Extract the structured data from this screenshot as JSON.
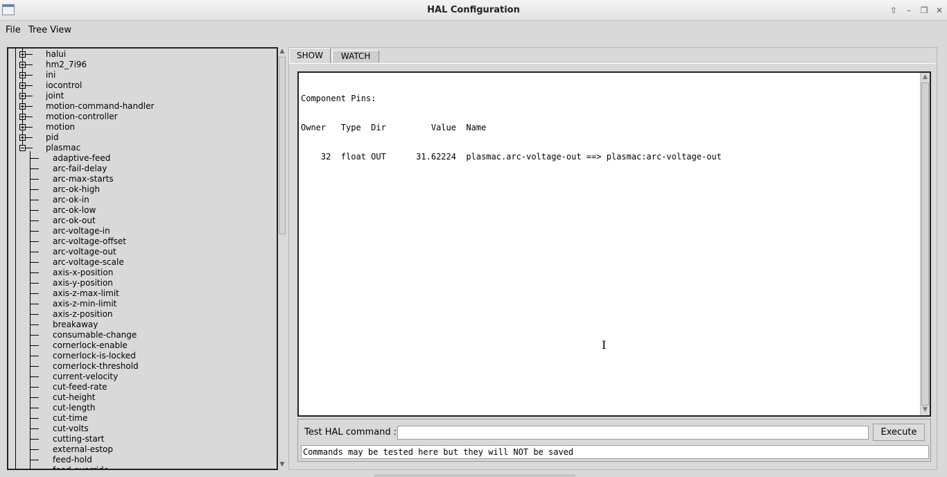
{
  "window": {
    "title": "HAL Configuration",
    "controls": [
      "up-icon",
      "minimize-icon",
      "maximize-icon",
      "close-icon"
    ]
  },
  "menubar": {
    "file": "File",
    "tree_view": "Tree View"
  },
  "tree": {
    "nodes": [
      {
        "label": "halui",
        "expanded": false
      },
      {
        "label": "hm2_7i96",
        "expanded": false
      },
      {
        "label": "ini",
        "expanded": false
      },
      {
        "label": "iocontrol",
        "expanded": false
      },
      {
        "label": "joint",
        "expanded": false
      },
      {
        "label": "motion-command-handler",
        "expanded": false
      },
      {
        "label": "motion-controller",
        "expanded": false
      },
      {
        "label": "motion",
        "expanded": false
      },
      {
        "label": "pid",
        "expanded": false
      },
      {
        "label": "plasmac",
        "expanded": true
      }
    ],
    "children": [
      "adaptive-feed",
      "arc-fail-delay",
      "arc-max-starts",
      "arc-ok-high",
      "arc-ok-in",
      "arc-ok-low",
      "arc-ok-out",
      "arc-voltage-in",
      "arc-voltage-offset",
      "arc-voltage-out",
      "arc-voltage-scale",
      "axis-x-position",
      "axis-y-position",
      "axis-z-max-limit",
      "axis-z-min-limit",
      "axis-z-position",
      "breakaway",
      "consumable-change",
      "cornerlock-enable",
      "cornerlock-is-locked",
      "cornerlock-threshold",
      "current-velocity",
      "cut-feed-rate",
      "cut-height",
      "cut-length",
      "cut-time",
      "cut-volts",
      "cutting-start",
      "external-estop",
      "feed-hold",
      "feed-override"
    ]
  },
  "tabs": {
    "show": "SHOW",
    "watch": "WATCH"
  },
  "output": {
    "lines": [
      "Component Pins:",
      "Owner   Type  Dir         Value  Name",
      "    32  float OUT      31.62224  plasmac.arc-voltage-out ==> plasmac:arc-voltage-out"
    ]
  },
  "command": {
    "label": "Test HAL command :",
    "value": "",
    "execute_label": "Execute",
    "status": "Commands may be tested here but they will NOT be saved"
  },
  "colors": {
    "background": "#d9d9d9",
    "text_bg": "#ffffff",
    "frame_border": "#222222"
  }
}
